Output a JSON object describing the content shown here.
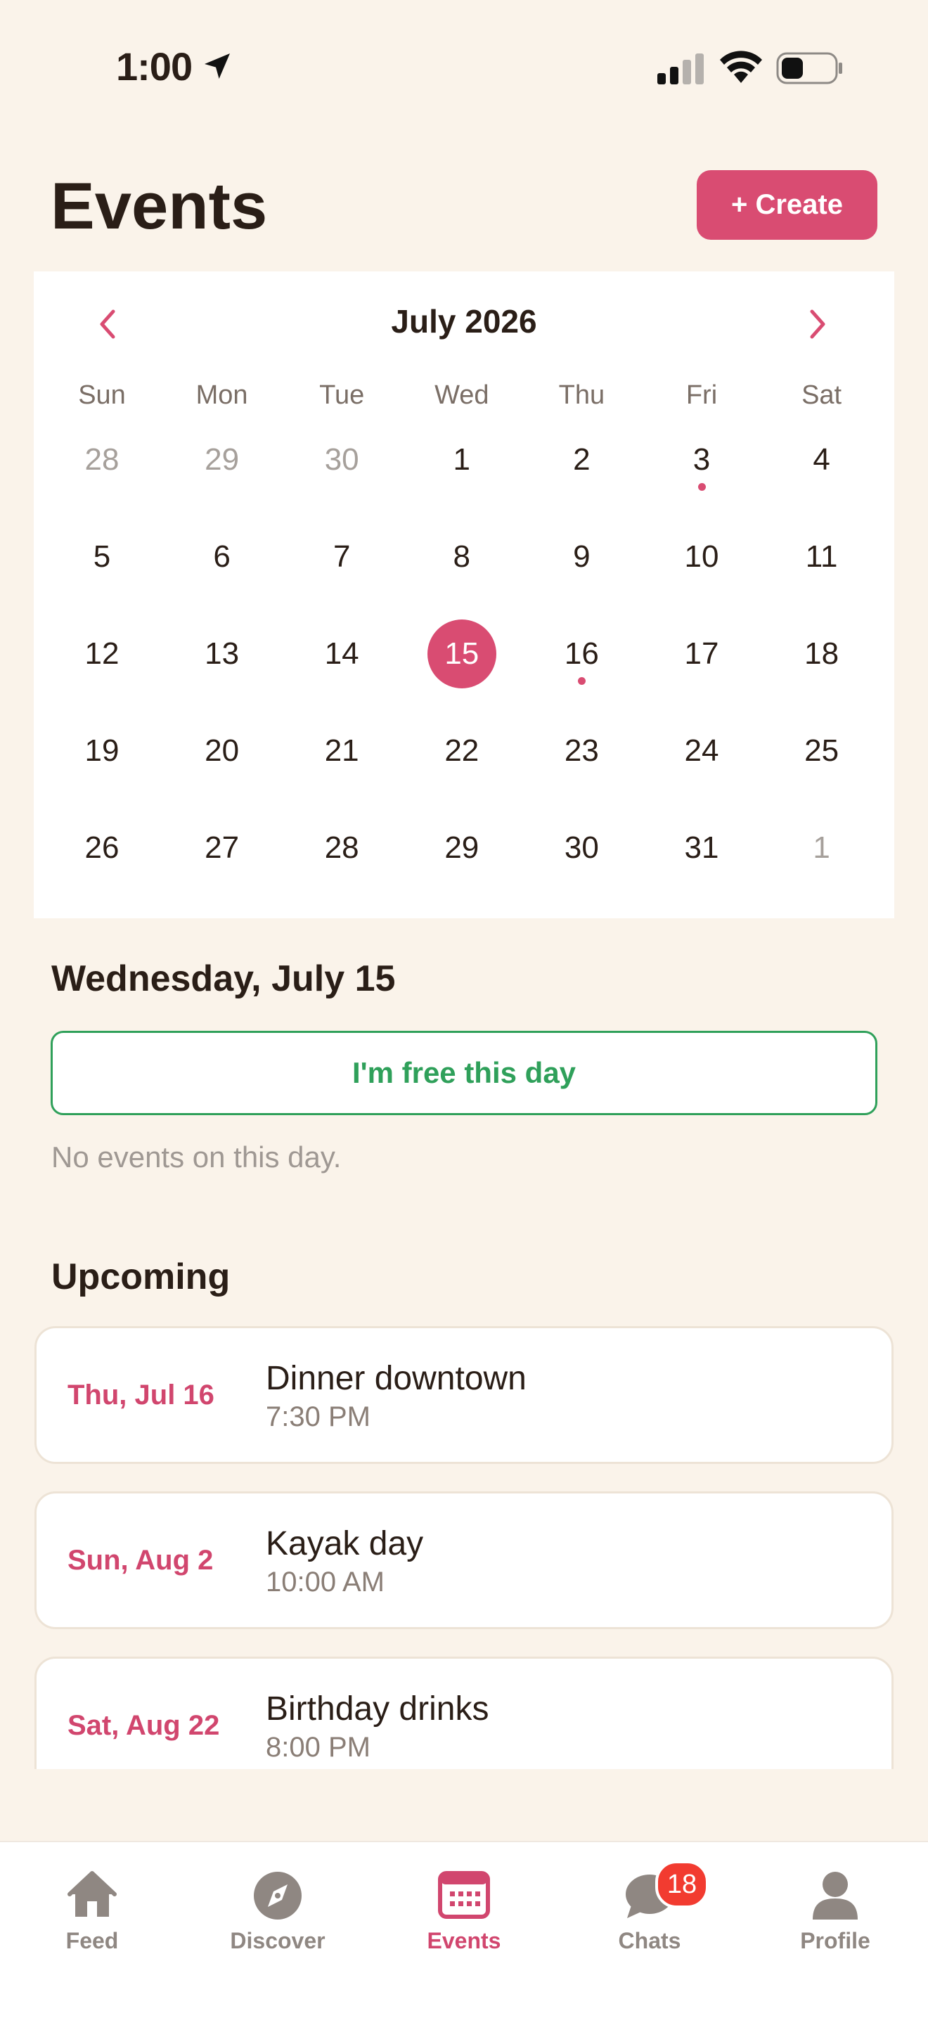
{
  "status_bar": {
    "time": "1:00"
  },
  "header": {
    "title": "Events",
    "create_label": "+ Create"
  },
  "calendar": {
    "month_label": "July 2026",
    "weekdays": [
      "Sun",
      "Mon",
      "Tue",
      "Wed",
      "Thu",
      "Fri",
      "Sat"
    ],
    "weeks": [
      [
        "28",
        "29",
        "30",
        "1",
        "2",
        "3",
        "4"
      ],
      [
        "5",
        "6",
        "7",
        "8",
        "9",
        "10",
        "11"
      ],
      [
        "12",
        "13",
        "14",
        "15",
        "16",
        "17",
        "18"
      ],
      [
        "19",
        "20",
        "21",
        "22",
        "23",
        "24",
        "25"
      ],
      [
        "26",
        "27",
        "28",
        "29",
        "30",
        "31",
        "1"
      ]
    ],
    "selected_day": "15",
    "days_with_events": [
      "3",
      "16"
    ],
    "outside_month_first_row": 3,
    "outside_month_last_row": 1
  },
  "selected_day": {
    "heading": "Wednesday, July 15",
    "free_label": "I'm free this day",
    "empty_text": "No events on this day."
  },
  "upcoming": {
    "heading": "Upcoming",
    "events": [
      {
        "date": "Thu, Jul 16",
        "title": "Dinner downtown",
        "time": "7:30 PM"
      },
      {
        "date": "Sun, Aug 2",
        "title": "Kayak day",
        "time": "10:00 AM"
      },
      {
        "date": "Sat, Aug 22",
        "title": "Birthday drinks",
        "time": "8:00 PM"
      }
    ]
  },
  "tab_bar": {
    "tabs": [
      {
        "label": "Feed",
        "icon": "home-icon"
      },
      {
        "label": "Discover",
        "icon": "compass-icon"
      },
      {
        "label": "Events",
        "icon": "calendar-icon"
      },
      {
        "label": "Chats",
        "icon": "chat-bubble-icon",
        "badge": "18"
      },
      {
        "label": "Profile",
        "icon": "person-icon"
      }
    ],
    "active": "Events"
  },
  "colors": {
    "accent": "#D94C72",
    "free": "#2FA05A",
    "background": "#FAF3EA",
    "badge": "#F23B30"
  }
}
